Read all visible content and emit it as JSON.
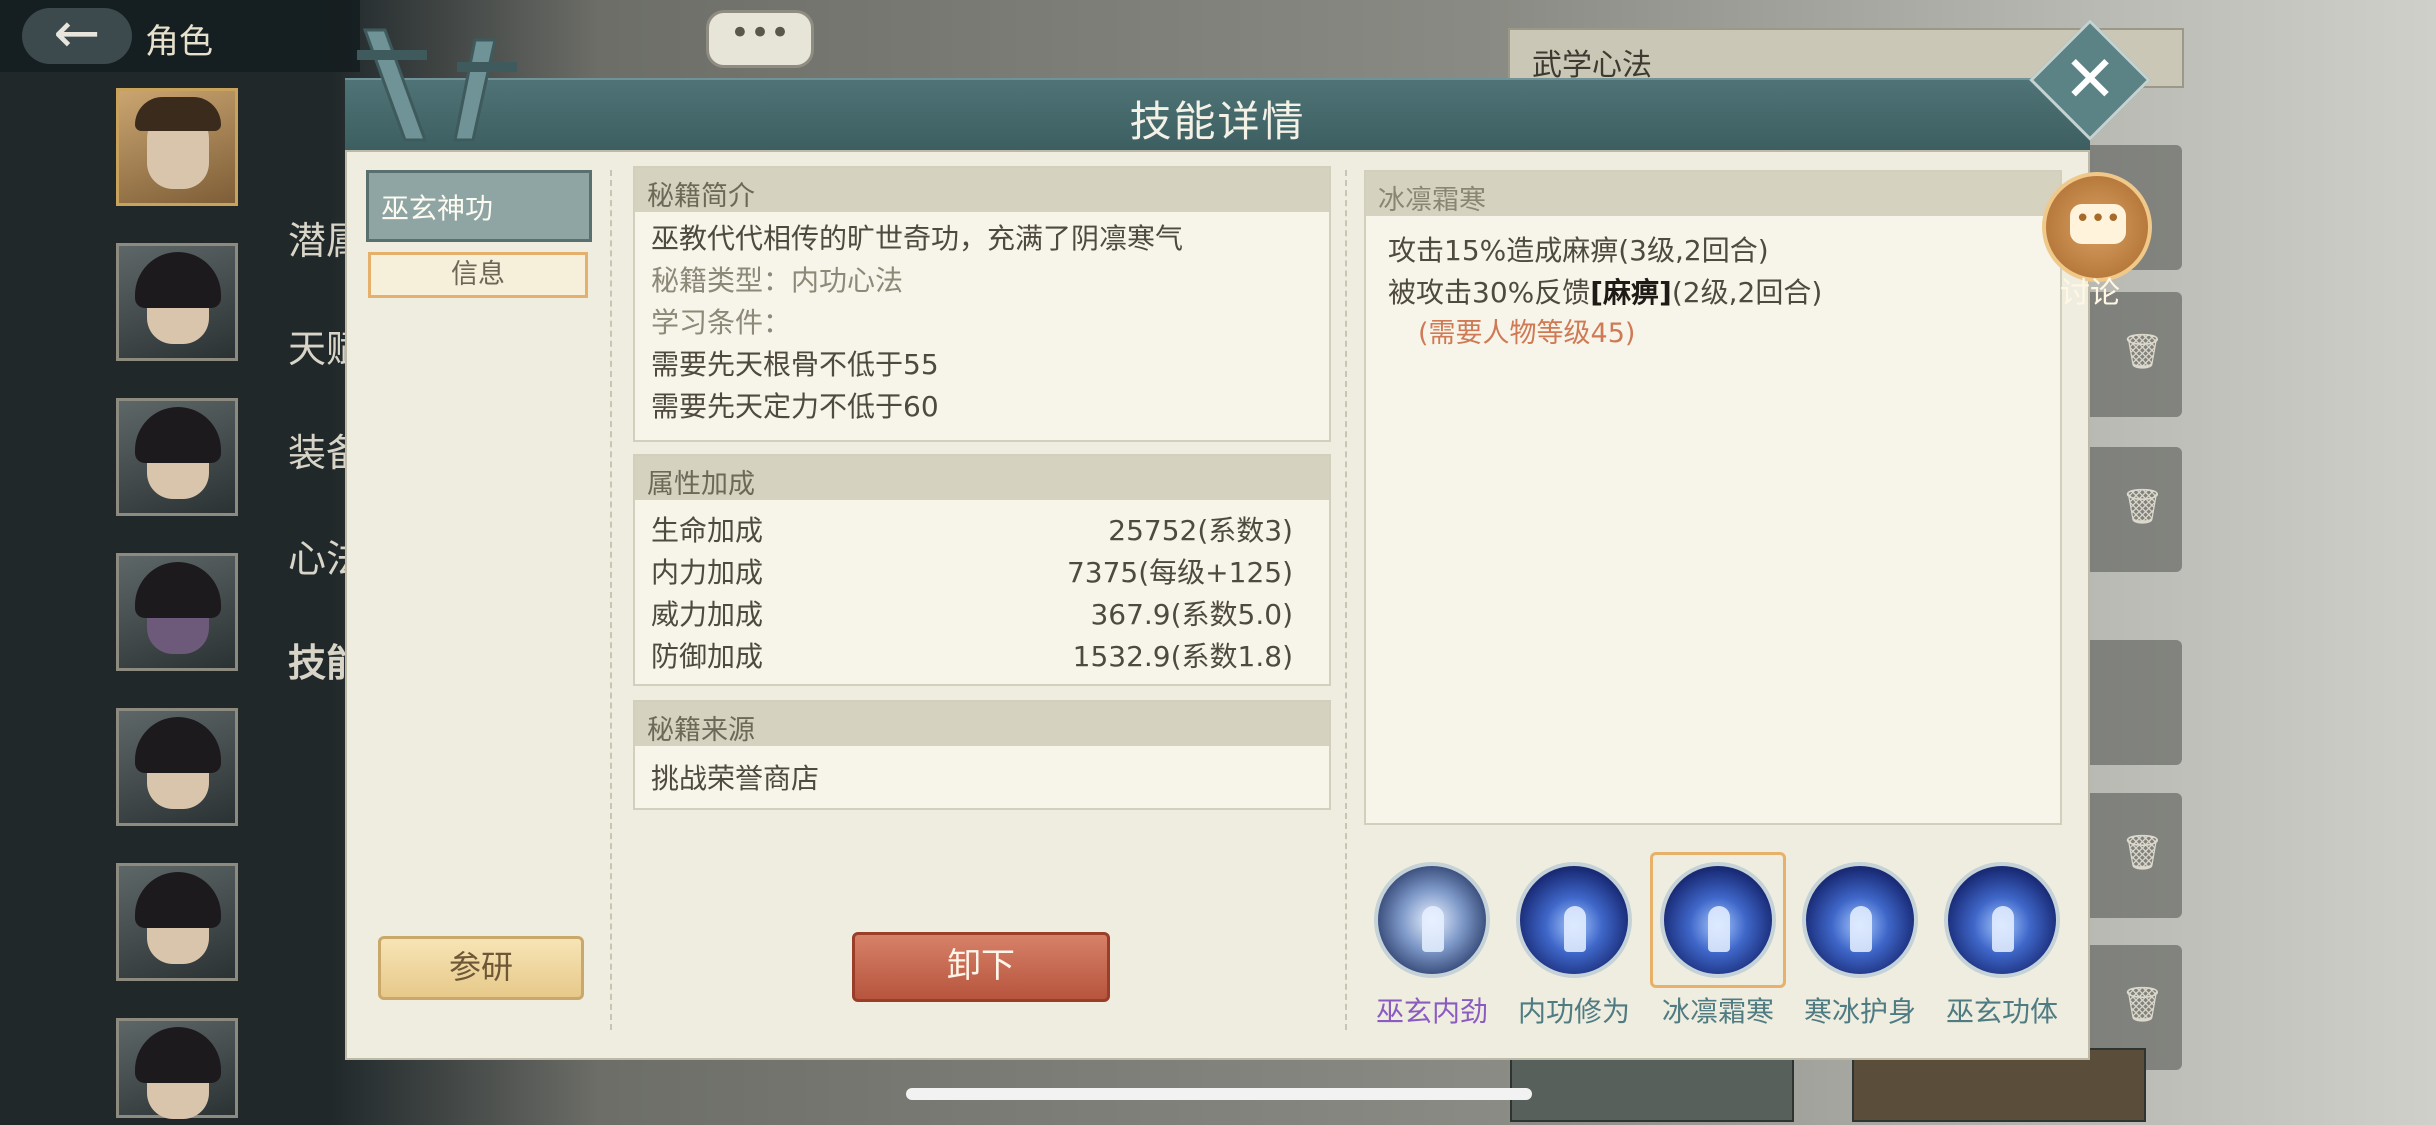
{
  "topbar": {
    "back_icon": "arrow-left-icon",
    "title": "角色"
  },
  "side_menu": [
    "潜属",
    "天赋",
    "装备",
    "心法",
    "技能"
  ],
  "right_panel": {
    "header": "武学心法"
  },
  "dialog": {
    "title": "技能详情",
    "left_tabs": {
      "active": "巫玄神功",
      "info": "信息"
    },
    "secret_intro": {
      "header": "秘籍简介",
      "desc": "巫教代代相传的旷世奇功，充满了阴凛寒气",
      "type": "秘籍类型：内功心法",
      "cond_label": "学习条件：",
      "cond1": "需要先天根骨不低于55",
      "cond2": "需要先天定力不低于60"
    },
    "attr_bonus": {
      "header": "属性加成",
      "rows": [
        {
          "name": "生命加成",
          "value": "25752(系数3)"
        },
        {
          "name": "内力加成",
          "value": "7375(每级+125)"
        },
        {
          "name": "威力加成",
          "value": "367.9(系数5.0)"
        },
        {
          "name": "防御加成",
          "value": "1532.9(系数1.8)"
        }
      ]
    },
    "source": {
      "header": "秘籍来源",
      "text": "挑战荣誉商店"
    },
    "skill_detail": {
      "header": "冰凛霜寒",
      "line1": "攻击15%造成麻痹(3级,2回合)",
      "line2_pre": "被攻击30%反馈",
      "line2_hl": "[麻痹]",
      "line2_post": "(2级,2回合)",
      "req": "(需要人物等级45)"
    },
    "skills": [
      "巫玄内劲",
      "内功修为",
      "冰凛霜寒",
      "寒冰护身",
      "巫玄功体"
    ],
    "selected_skill_index": 2,
    "buttons": {
      "study": "参研",
      "unequip": "卸下"
    },
    "discuss_label": "讨论"
  },
  "colors": {
    "header_teal": "#4f7376",
    "unequip_red": "#b7553e",
    "req_orange": "#cf7a55"
  }
}
